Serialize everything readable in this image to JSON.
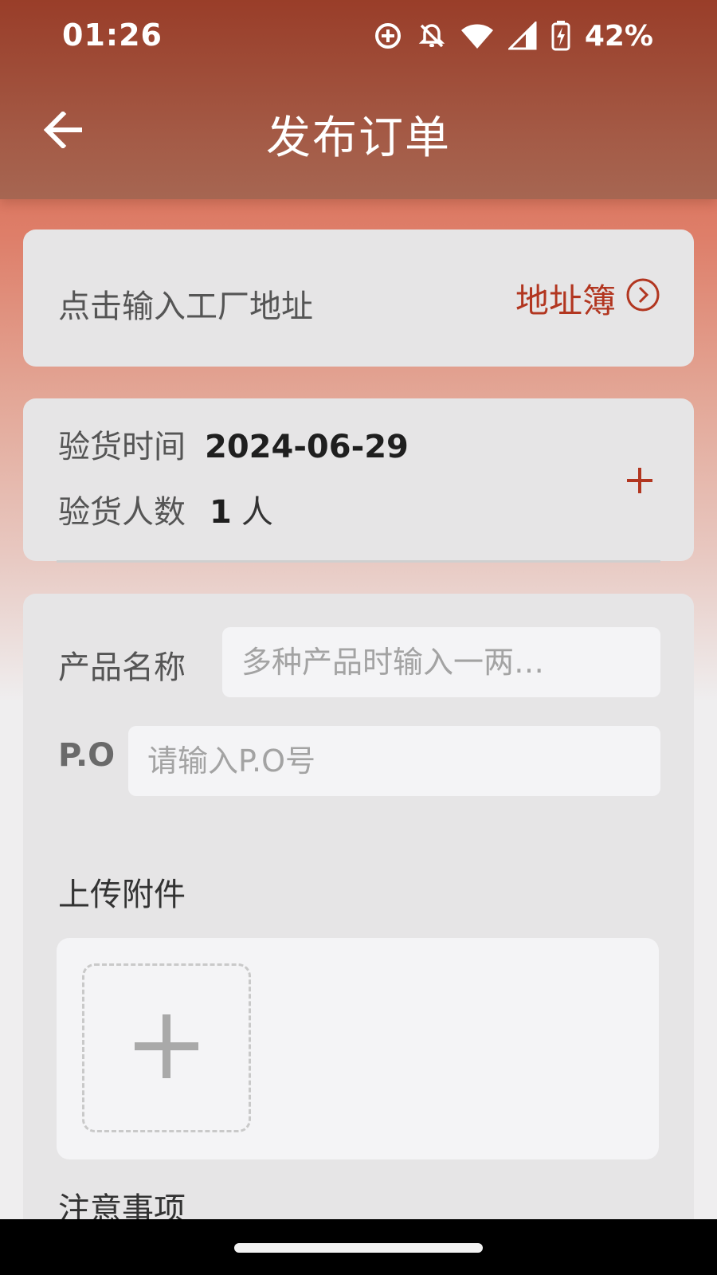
{
  "status_bar": {
    "time": "01:26",
    "battery_percent": "42%",
    "icons": [
      "data-saver-icon",
      "notifications-off-icon",
      "wifi-icon",
      "signal-icon",
      "battery-charging-icon"
    ]
  },
  "app_bar": {
    "title": "发布订单",
    "back_icon": "arrow-left-icon"
  },
  "address_card": {
    "placeholder": "点击输入工厂地址",
    "address_book_label": "地址簿",
    "address_book_icon": "chevron-right-circle-icon"
  },
  "inspection_card": {
    "time_label": "验货时间",
    "time_value": "2024-06-29",
    "count_label": "验货人数",
    "count_value": "1",
    "count_unit": "人",
    "add_icon": "plus-icon"
  },
  "product_card": {
    "product_name_label": "产品名称",
    "product_name_placeholder": "多种产品时输入一两…",
    "po_label": "P.O",
    "po_placeholder": "请输入P.O号",
    "upload_label": "上传附件",
    "upload_icon": "plus-icon",
    "notes_label": "注意事项"
  },
  "colors": {
    "accent": "#b23620",
    "header": "#a24a35",
    "card_bg": "#e6e5e6",
    "input_bg": "#f4f4f6"
  }
}
